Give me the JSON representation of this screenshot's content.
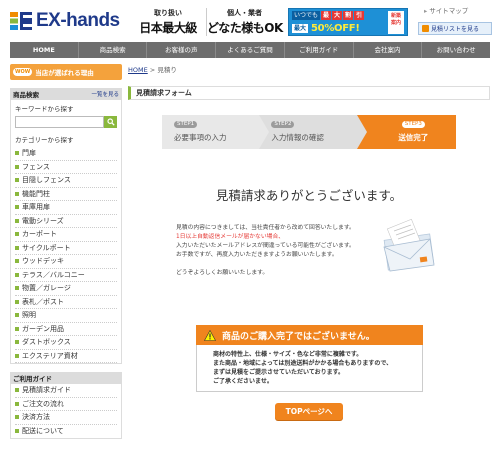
{
  "header": {
    "logo_text": "EX-hands",
    "tag1_small": "取り扱い",
    "tag1_big": "日本最大級",
    "tag2_small": "個人・業者",
    "tag2_big": "どなた様もOK",
    "banner_label": "いつでも",
    "banner_chars": [
      "最",
      "大",
      "割",
      "引"
    ],
    "banner_max": "最大",
    "banner_pct": "50%OFF!",
    "banner_coupon": "新築 案内",
    "sitemap": "サイトマップ",
    "estimate_list": "見積リストを見る"
  },
  "nav": [
    "HOME",
    "商品検索",
    "お客様の声",
    "よくあるご質問",
    "ご利用ガイド",
    "会社案内",
    "お問い合わせ"
  ],
  "sidebar": {
    "reason_badge": "WOW",
    "reason_text": "当店が選ばれる理由",
    "search_title": "商品検索",
    "search_more": "一覧を見る",
    "keyword_label": "キーワードから探す",
    "category_label": "カテゴリーから探す",
    "categories": [
      "門扉",
      "フェンス",
      "目隠しフェンス",
      "機能門柱",
      "車庫用扉",
      "電動シリーズ",
      "カーポート",
      "サイクルポート",
      "ウッドデッキ",
      "テラス／バルコニー",
      "物置／ガレージ",
      "表札／ポスト",
      "照明",
      "ガーデン用品",
      "ダストボックス",
      "エクステリア資材"
    ],
    "guide_title": "ご利用ガイド",
    "guide_items": [
      "見積請求ガイド",
      "ご注文の流れ",
      "決済方法",
      "配送について"
    ]
  },
  "main": {
    "breadcrumb_home": "HOME",
    "breadcrumb_sep": " > ",
    "breadcrumb_current": "見積り",
    "title": "見積請求フォーム",
    "steps": [
      {
        "num": "STEP1",
        "label": "必要事項の入力"
      },
      {
        "num": "STEP2",
        "label": "入力情報の確認"
      },
      {
        "num": "STEP3",
        "label": "送信完了"
      }
    ],
    "thanks": "見積請求ありがとうございます。",
    "msg_line1": "見積の内容につきましては、当社責任者から改めて回答いたします。",
    "msg_red": "1日以上自動返信メールが届かない場合、",
    "msg_line3": "入力いただいたメールアドレスが間違っている可能性がございます。",
    "msg_line4": "お手数ですが、再度入力いただきますようお願いいたします。",
    "msg_line5": "どうぞよろしくお願いいたします。",
    "notice_title": "商品のご購入完了ではございません。",
    "notice_lines": [
      "商材の特性上、仕様・サイズ・色など非常に複雑です。",
      "また商品・地域によっては別途送料がかかる場合もありますので、",
      "まずは見積をご提示させていただいております。",
      "ご了承くださいませ。"
    ],
    "top_button": "TOPページへ"
  },
  "colors": {
    "accent": "#f0841e",
    "green": "#8ab83d",
    "nav": "#6d6d6d",
    "navy": "#1f3a8a"
  }
}
